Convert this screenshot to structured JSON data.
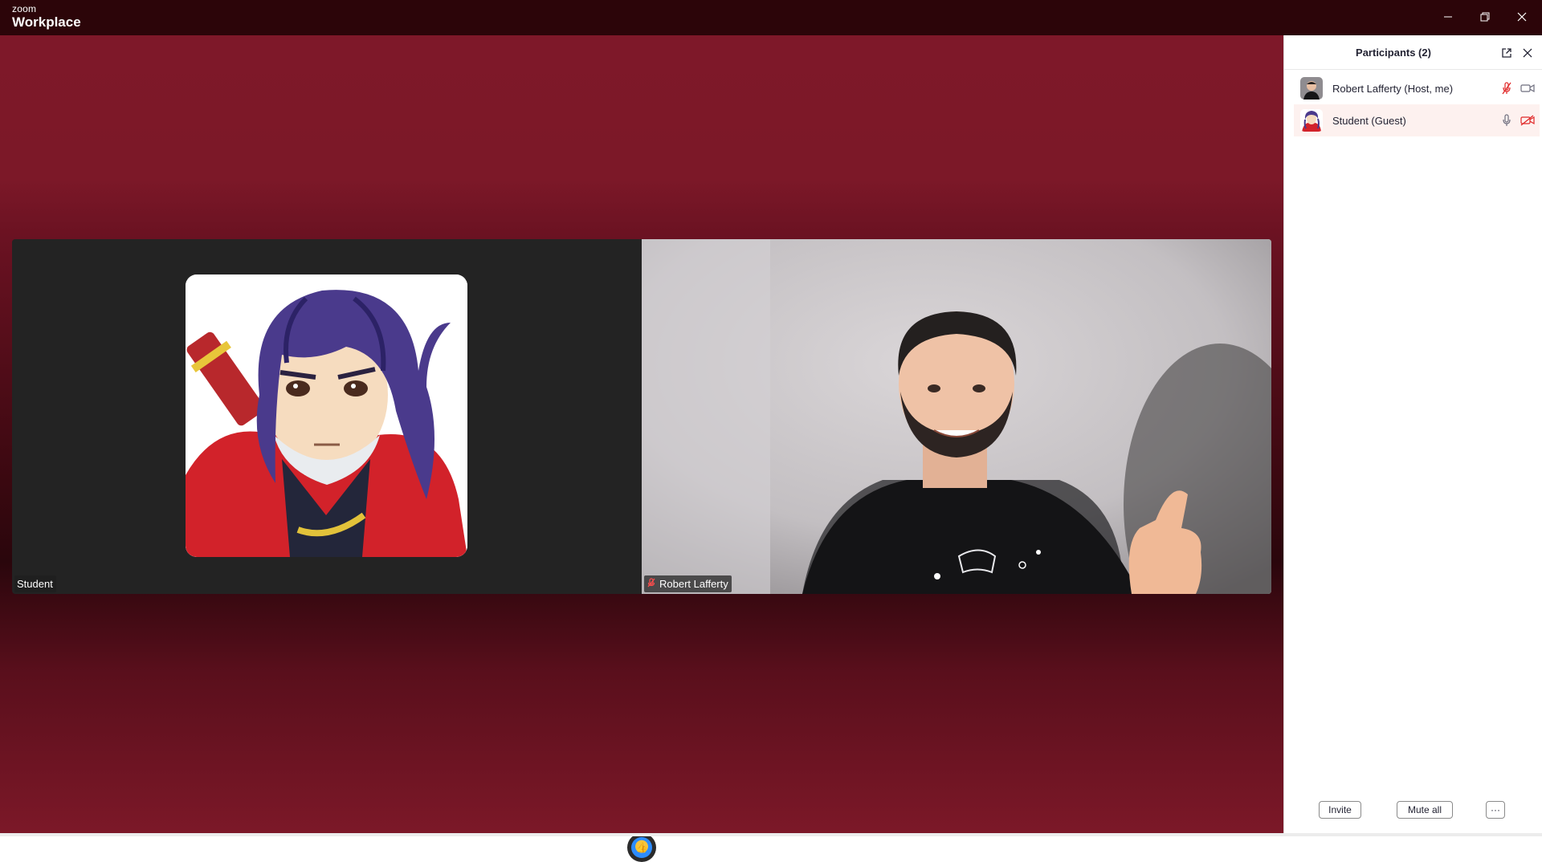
{
  "app": {
    "brand_small": "zoom",
    "brand_big": "Workplace"
  },
  "window_controls": {
    "minimize_icon": "minimize-icon",
    "restore_icon": "restore-icon",
    "close_icon": "close-icon"
  },
  "stage": {
    "tiles": [
      {
        "name": "Student",
        "muted": false,
        "kind": "avatar"
      },
      {
        "name": "Robert Lafferty",
        "muted": true,
        "kind": "camera"
      }
    ],
    "reaction_icon": "thumbs-up-reaction-icon"
  },
  "participants": {
    "title": "Participants (2)",
    "list": [
      {
        "name": "Robert Lafferty (Host, me)",
        "mic": "muted",
        "video": "on"
      },
      {
        "name": "Student (Guest)",
        "mic": "on",
        "video": "off"
      }
    ],
    "buttons": {
      "invite": "Invite",
      "mute_all": "Mute all",
      "more": "···"
    }
  },
  "colors": {
    "titlebar": "#2c0509",
    "stage": "#7e1829",
    "muted_red": "#e02828",
    "highlight_row": "#fdf1ef"
  }
}
